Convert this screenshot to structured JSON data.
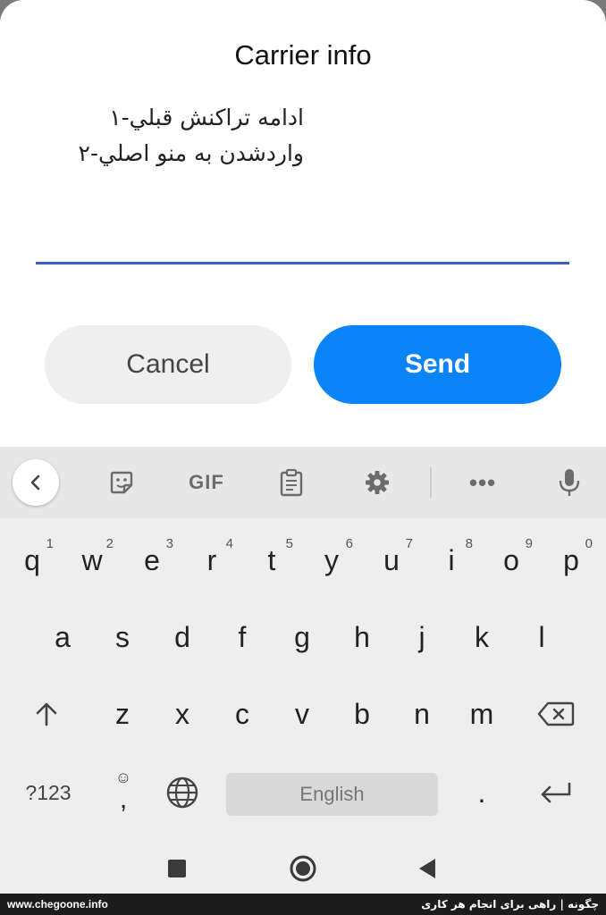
{
  "dialog": {
    "title": "Carrier info",
    "message_lines": [
      "ادامه تراکنش قبلي-۱",
      "واردشدن به منو اصلي-۲"
    ],
    "input_value": "",
    "cancel_label": "Cancel",
    "send_label": "Send",
    "accent_color": "#0a84f6",
    "input_underline_color": "#3b5fc9"
  },
  "keyboard": {
    "toolbar": {
      "back_icon": "chevron-left-icon",
      "sticker_icon": "sticker-icon",
      "gif_label": "GIF",
      "clipboard_icon": "clipboard-icon",
      "settings_icon": "gear-icon",
      "more_label": "•••",
      "mic_icon": "microphone-icon"
    },
    "row1": [
      {
        "key": "q",
        "sup": "1"
      },
      {
        "key": "w",
        "sup": "2"
      },
      {
        "key": "e",
        "sup": "3"
      },
      {
        "key": "r",
        "sup": "4"
      },
      {
        "key": "t",
        "sup": "5"
      },
      {
        "key": "y",
        "sup": "6"
      },
      {
        "key": "u",
        "sup": "7"
      },
      {
        "key": "i",
        "sup": "8"
      },
      {
        "key": "o",
        "sup": "9"
      },
      {
        "key": "p",
        "sup": "0"
      }
    ],
    "row2": [
      "a",
      "s",
      "d",
      "f",
      "g",
      "h",
      "j",
      "k",
      "l"
    ],
    "row3": [
      "z",
      "x",
      "c",
      "v",
      "b",
      "n",
      "m"
    ],
    "symbols_label": "?123",
    "comma_label": ",",
    "emoji_label": "☺",
    "space_label": "English",
    "period_label": "."
  },
  "nav": {
    "recents_icon": "recents-icon",
    "home_icon": "home-icon",
    "back_icon": "back-icon"
  },
  "watermark": {
    "left": "www.chegoone.info",
    "right": "چگونه | راهی برای انجام هر کاری"
  }
}
